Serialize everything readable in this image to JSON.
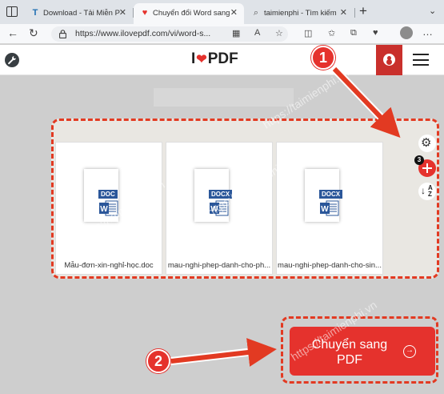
{
  "browser": {
    "tabs": [
      {
        "label": "Download - Tải Miễn Phí VN",
        "favicon": "T",
        "active": false
      },
      {
        "label": "Chuyển đổi Word sang PDF",
        "favicon": "♥",
        "active": true
      },
      {
        "label": "taimienphi - Tìm kiếm",
        "favicon": "⌕",
        "active": false
      }
    ],
    "new_tab": "+",
    "url": "https://www.ilovepdf.com/vi/word-s..."
  },
  "site": {
    "logo_left": "I",
    "logo_right": "PDF",
    "brand_color": "#e5322d"
  },
  "files": [
    {
      "type": "DOC",
      "name": "Mẫu-đơn-xin-nghỉ-học.doc"
    },
    {
      "type": "DOCX",
      "name": "mau-nghi-phep-danh-cho-ph..."
    },
    {
      "type": "DOCX",
      "name": "mau-nghi-phep-danh-cho-sin..."
    }
  ],
  "file_count": "3",
  "actions": {
    "convert_label": "Chuyển sang PDF"
  },
  "annotations": {
    "step1": "1",
    "step2": "2",
    "accent": "#e23a22"
  },
  "watermark": "https://taimienphi.vn"
}
